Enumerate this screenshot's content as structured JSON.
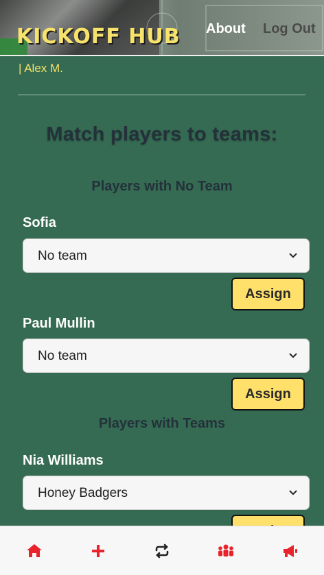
{
  "header": {
    "logo": "KICKOFF HUB",
    "about": "About",
    "logout": "Log Out"
  },
  "user": "| Alex M.",
  "title": "Match players to teams:",
  "sections": {
    "no_team": "Players with No Team",
    "with_teams": "Players with Teams"
  },
  "players": [
    {
      "name": "Sofia",
      "team": "No team",
      "button": "Assign"
    },
    {
      "name": "Paul Mullin",
      "team": "No team",
      "button": "Assign"
    },
    {
      "name": "Nia Williams",
      "team": "Honey Badgers",
      "button": "Assign"
    }
  ],
  "bottom_nav": [
    {
      "icon": "home-icon"
    },
    {
      "icon": "plus-icon"
    },
    {
      "icon": "swap-icon"
    },
    {
      "icon": "users-icon"
    },
    {
      "icon": "megaphone-icon"
    }
  ],
  "colors": {
    "accent": "#ffe06b",
    "background": "#356b52",
    "nav_icon": "#e8232b"
  }
}
